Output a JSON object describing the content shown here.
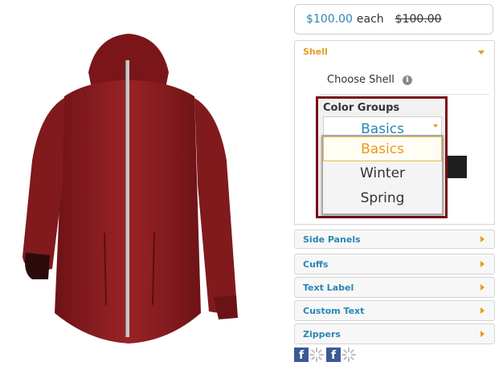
{
  "price": {
    "current": "$100.00",
    "each": "each",
    "original": "$100.00"
  },
  "shell": {
    "label": "Shell",
    "choose_label": "Choose Shell",
    "info_glyph": "i",
    "color_groups": {
      "title": "Color Groups",
      "selected": "Basics",
      "options": [
        "Basics",
        "Winter",
        "Spring"
      ]
    }
  },
  "sections": {
    "side_panels": "Side Panels",
    "cuffs": "Cuffs",
    "text_label": "Text Label",
    "custom_text": "Custom Text",
    "zippers": "Zippers"
  },
  "social": {
    "fb_glyph": "f"
  },
  "colors": {
    "accent_orange": "#e69a1f",
    "link_blue": "#2a86b3",
    "highlight_border": "#7a0e12",
    "jacket": "#8b1c1f"
  }
}
